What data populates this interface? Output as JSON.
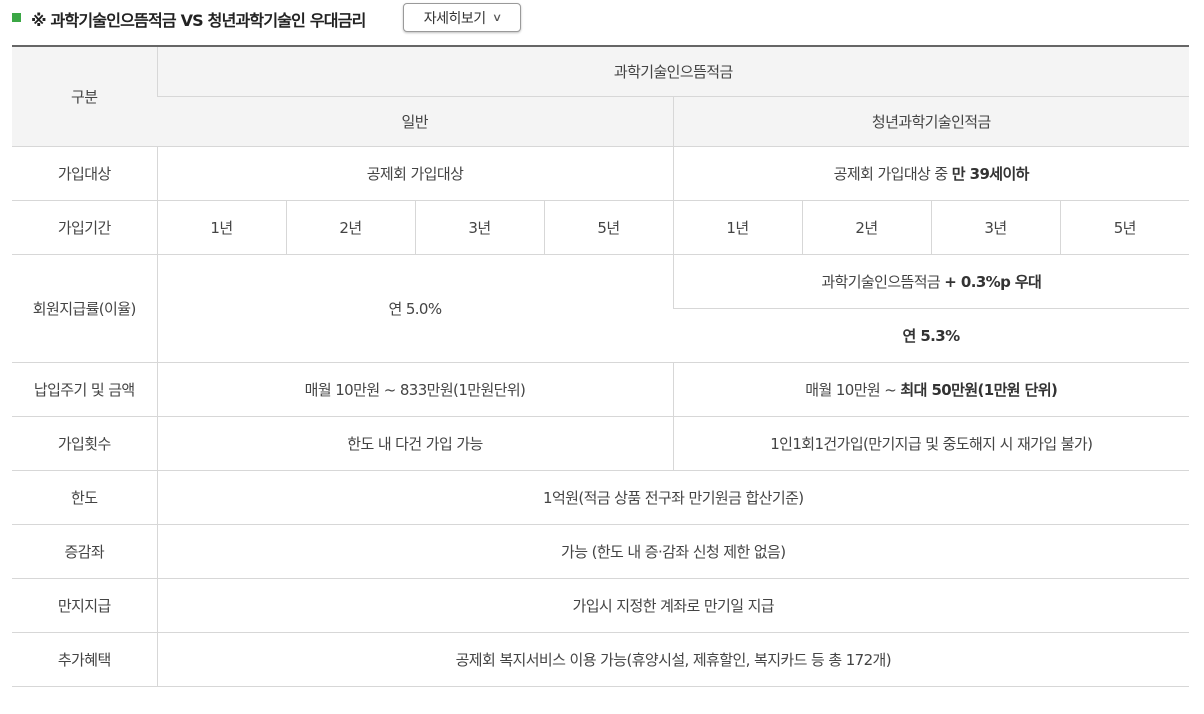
{
  "header": {
    "title": "※ 과학기술인으뜸적금 VS 청년과학기술인 우대금리",
    "more_button": "자세히보기"
  },
  "table": {
    "col_category": "구분",
    "col_product": "과학기술인으뜸적금",
    "col_general": "일반",
    "col_youth": "청년과학기술인적금",
    "rows": {
      "eligibility": {
        "label": "가입대상",
        "general": "공제회 가입대상",
        "youth_prefix": "공제회 가입대상 중 ",
        "youth_bold": "만 39세이하"
      },
      "period": {
        "label": "가입기간",
        "general": [
          "1년",
          "2년",
          "3년",
          "5년"
        ],
        "youth": [
          "1년",
          "2년",
          "3년",
          "5년"
        ]
      },
      "rate": {
        "label": "회원지급률(이율)",
        "general": "연 5.0%",
        "youth_line1_prefix": "과학기술인으뜸적금 ",
        "youth_line1_bold": "+ 0.3%p 우대",
        "youth_line2": "연 5.3%"
      },
      "payment": {
        "label": "납입주기 및 금액",
        "general": "매월 10만원 ~ 833만원(1만원단위)",
        "youth_prefix": "매월 10만원 ~ ",
        "youth_bold": "최대 50만원(1만원 단위)"
      },
      "count": {
        "label": "가입횟수",
        "general": "한도 내 다건 가입 가능",
        "youth": "1인1회1건가입(만기지급 및 중도해지 시 재가입 불가)"
      },
      "limit": {
        "label": "한도",
        "value": "1억원(적금 상품 전구좌 만기원금 합산기준)"
      },
      "adjust": {
        "label": "증감좌",
        "value": "가능 (한도 내 증·감좌 신청 제한 없음)"
      },
      "maturity": {
        "label": "만지지급",
        "value": "가입시 지정한 계좌로 만기일 지급"
      },
      "benefit": {
        "label": "추가혜택",
        "value": "공제회 복지서비스 이용 가능(휴양시설, 제휴할인, 복지카드 등 총 172개)"
      }
    }
  },
  "colors": {
    "bullet": "#3ba745",
    "header_bg": "#f4f4f4",
    "border": "#d7d7d7",
    "top_border": "#666666"
  }
}
